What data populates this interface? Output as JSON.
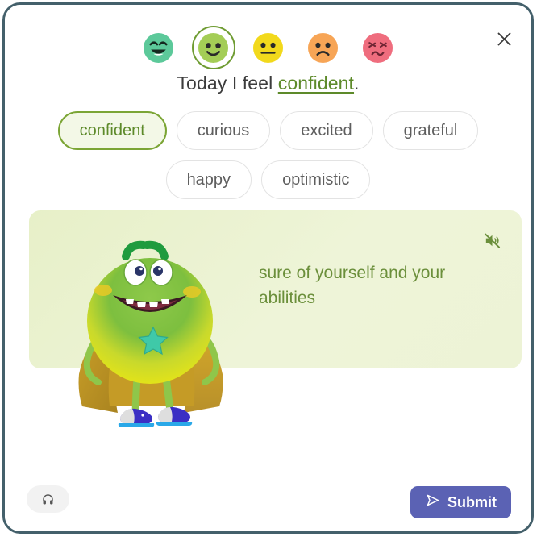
{
  "window": {
    "close_label": "×",
    "border_color": "#44606b"
  },
  "mood_scale": {
    "icon_name": "mood-face-icon",
    "selected_index": 1,
    "faces": [
      {
        "name": "very-happy-face",
        "mood": "very happy",
        "color": "#5cc99a",
        "expression": "grin"
      },
      {
        "name": "happy-face",
        "mood": "happy",
        "color": "#a4cd56",
        "expression": "smile"
      },
      {
        "name": "neutral-face",
        "mood": "neutral",
        "color": "#f2d91c",
        "expression": "flat"
      },
      {
        "name": "sad-face",
        "mood": "sad",
        "color": "#f7a556",
        "expression": "frown"
      },
      {
        "name": "upset-face",
        "mood": "upset",
        "color": "#ef6d7e",
        "expression": "distressed"
      }
    ],
    "selection_ring_color": "#6f9c33"
  },
  "sentence": {
    "prefix": "Today I feel ",
    "word": "confident",
    "suffix": ".",
    "word_color": "#5d8a2a"
  },
  "chips": {
    "selected": "confident",
    "items": [
      {
        "label": "confident",
        "selected": true
      },
      {
        "label": "curious",
        "selected": false
      },
      {
        "label": "excited",
        "selected": false
      },
      {
        "label": "grateful",
        "selected": false
      },
      {
        "label": "happy",
        "selected": false
      },
      {
        "label": "optimistic",
        "selected": false
      }
    ],
    "selected_border_color": "#7ba535",
    "selected_fill_color": "#f3f8e7"
  },
  "definition_panel": {
    "text": "sure of yourself and your abilities",
    "text_color": "#6b8f3b",
    "background_color": "#eaf1cd",
    "mute_icon": "speaker-muted-icon",
    "character_name": "green-monster-mascot"
  },
  "footer": {
    "audio_button_icon": "headphones-icon",
    "submit_label": "Submit",
    "submit_icon": "send-icon",
    "submit_color": "#5b62b4"
  }
}
